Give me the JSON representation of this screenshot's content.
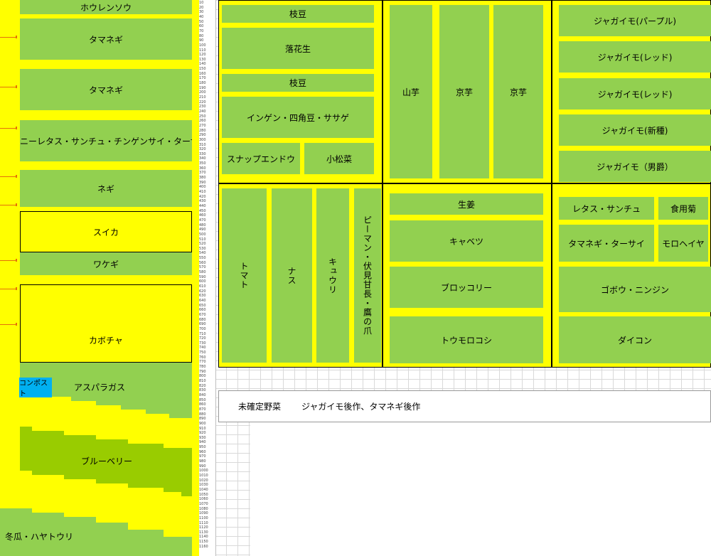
{
  "left_column": {
    "spinach": "ホウレンソウ",
    "onion_1": "タマネギ",
    "onion_2": "タマネギ",
    "lettuce_row": "サニーレタス・サンチュ・チンゲンサイ・ターサイ",
    "negi": "ネギ",
    "watermelon": "スイカ",
    "wakegi": "ワケギ",
    "pumpkin": "カボチャ",
    "compost": "コンポスト",
    "asparagus": "アスパラガス",
    "blueberry": "ブルーベリー",
    "winter_melon": "冬瓜・ハヤトウリ"
  },
  "block_top_left": {
    "edamame_1": "枝豆",
    "peanut": "落花生",
    "edamame_2": "枝豆",
    "beans": "インゲン・四角豆・ササゲ",
    "snap_pea": "スナップエンドウ",
    "komatsuna": "小松菜"
  },
  "block_top_mid": {
    "yamaimo": "山芋",
    "kyoimo_1": "京芋",
    "kyoimo_2": "京芋"
  },
  "block_top_right": {
    "potato_purple": "ジャガイモ(パープル)",
    "potato_red_1": "ジャガイモ(レッド)",
    "potato_red_2": "ジャガイモ(レッド)",
    "potato_new": "ジャガイモ(新種)",
    "potato_danshaku": "ジャガイモ（男爵）"
  },
  "block_bottom_left": {
    "tomato": "トマト",
    "eggplant": "ナス",
    "cucumber": "キュウリ",
    "pepper": "ピーマン・伏見甘長・鷹の爪"
  },
  "block_bottom_mid": {
    "ginger": "生姜",
    "cabbage": "キャベツ",
    "broccoli": "ブロッコリー",
    "corn": "トウモロコシ"
  },
  "block_bottom_right": {
    "lettuce": "レタス・サンチュ",
    "edible_chrysanthemum": "食用菊",
    "onion_tasai": "タマネギ・ターサイ",
    "moroheiya": "モロヘイヤ",
    "burdock_carrot": "ゴボウ・ニンジン",
    "daikon": "ダイコン"
  },
  "undecided": {
    "label": "未確定野菜",
    "value": "ジャガイモ後作、タマネギ後作"
  },
  "ruler": {
    "labels": [
      "10",
      "20",
      "30",
      "40",
      "50",
      "60",
      "70",
      "80",
      "90",
      "100",
      "110",
      "120",
      "130",
      "140",
      "150",
      "160",
      "170",
      "180",
      "190",
      "200",
      "210",
      "220",
      "230",
      "240",
      "250",
      "260",
      "270",
      "280",
      "290",
      "300",
      "310",
      "320",
      "330",
      "340",
      "350",
      "360",
      "370",
      "380",
      "390",
      "400",
      "410",
      "420",
      "430",
      "440",
      "450",
      "460",
      "470",
      "480",
      "490",
      "500",
      "510",
      "520",
      "530",
      "540",
      "550",
      "560",
      "570",
      "580",
      "590",
      "600",
      "610",
      "620",
      "630",
      "640",
      "650",
      "660",
      "670",
      "680",
      "690",
      "700",
      "710",
      "720",
      "730",
      "740",
      "750",
      "760",
      "770",
      "780",
      "790",
      "800",
      "810",
      "820",
      "830",
      "840",
      "850",
      "860",
      "870",
      "880",
      "890",
      "900",
      "910",
      "920",
      "930",
      "940",
      "950",
      "960",
      "970",
      "980",
      "990",
      "1000",
      "1010",
      "1020",
      "1030",
      "1040",
      "1050",
      "1060",
      "1070",
      "1080",
      "1090",
      "1100",
      "1110",
      "1120",
      "1130",
      "1140",
      "1150",
      "1160"
    ]
  },
  "colors": {
    "plot_green": "#92d050",
    "path_yellow": "#ffff00",
    "blueberry_green": "#99cc00",
    "compost_blue": "#00b0f0"
  }
}
